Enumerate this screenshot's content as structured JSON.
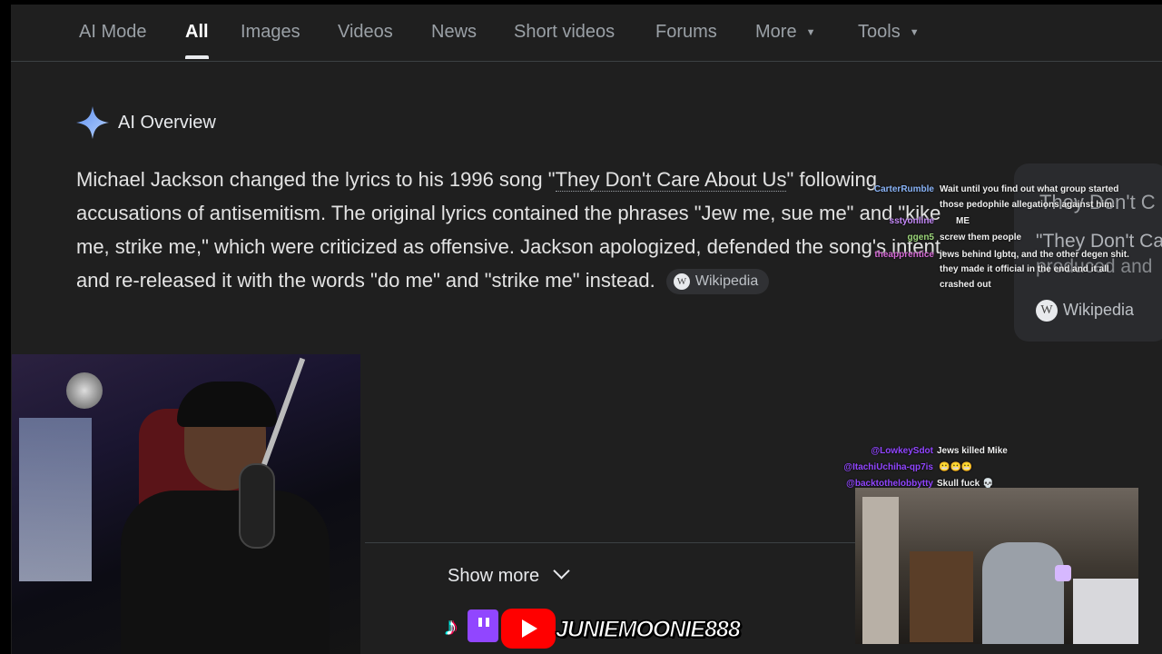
{
  "tabs": [
    {
      "label": "AI Mode"
    },
    {
      "label": "All"
    },
    {
      "label": "Images"
    },
    {
      "label": "Videos"
    },
    {
      "label": "News"
    },
    {
      "label": "Short videos"
    },
    {
      "label": "Forums"
    },
    {
      "label": "More"
    },
    {
      "label": "Tools"
    }
  ],
  "ai_overview": {
    "title": "AI Overview",
    "text_before_link": "Michael Jackson changed the lyrics to his 1996 song \"",
    "link": "They Don't Care About Us",
    "text_after_link": "\" following accusations of antisemitism. The original lyrics contained the phrases \"Jew me, sue me\" and \"kike me, strike me,\" which were criticized as offensive. Jackson apologized, defended the song's intent, and re-released it with the words \"do me\" and \"strike me\" instead.",
    "source_chip": "Wikipedia",
    "show_more": "Show more"
  },
  "side_card": {
    "title": "They Don't C",
    "subtitle": "\"They Don't Ca",
    "subtitle2": "produced and",
    "source": "Wikipedia"
  },
  "chat_top": [
    {
      "user": "CarterRumble",
      "user_color": "#8ab4f8",
      "message": "Wait until you find out what group started"
    },
    {
      "user": "",
      "user_color": "#ffffff",
      "message": "those pedophile allegations against him."
    },
    {
      "user": "sstyonline",
      "user_color": "#c58af9",
      "message": "ME"
    },
    {
      "user": "ggen5",
      "user_color": "#9cd67a",
      "message": "screw them people"
    },
    {
      "user": "theapprentice",
      "user_color": "#d66bd6",
      "message": "jews behind lgbtq, and the other degen shit."
    },
    {
      "user": "",
      "user_color": "#ffffff",
      "message": "they made it official in the end and it all"
    },
    {
      "user": "",
      "user_color": "#ffffff",
      "message": "crashed out"
    }
  ],
  "chat_bottom": [
    {
      "user": "@LowkeySdot",
      "user_color": "#9146ff",
      "message": "Jews killed Mike"
    },
    {
      "user": "@ItachiUchiha-qp7is",
      "user_color": "#9146ff",
      "message": "😬😬😬"
    },
    {
      "user": "@backtothelobbytty",
      "user_color": "#9146ff",
      "message": "Skull fuck 💀"
    }
  ],
  "socials": {
    "handle": "JUNIEMOONIE888",
    "tiktok_icon": "tiktok-icon",
    "twitch_icon": "twitch-icon",
    "youtube_icon": "youtube-icon"
  },
  "colors": {
    "background": "#1f1f1f",
    "text": "#e3e3e3",
    "muted": "#9aa0a6",
    "spark": "#8ab4f8"
  }
}
